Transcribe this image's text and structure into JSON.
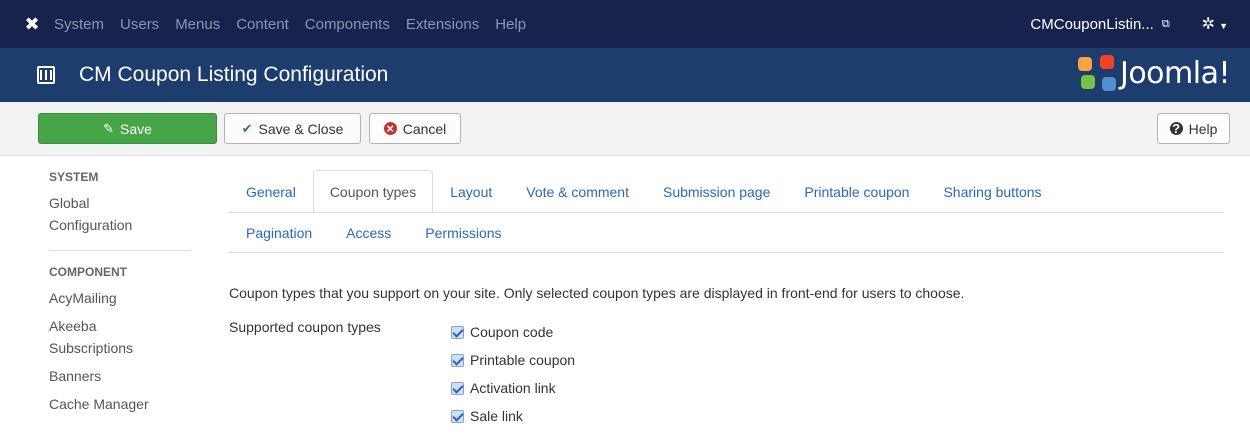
{
  "navbar": {
    "menu": [
      "System",
      "Users",
      "Menus",
      "Content",
      "Components",
      "Extensions",
      "Help"
    ],
    "site_link": "CMCouponListin...",
    "settings_icon": "gear-icon"
  },
  "header": {
    "title": "CM Coupon Listing Configuration",
    "logo_text": "Joomla!"
  },
  "toolbar": {
    "save_label": "Save",
    "save_close_label": "Save & Close",
    "cancel_label": "Cancel",
    "help_label": "Help"
  },
  "sidebar": {
    "system_heading": "SYSTEM",
    "system_items": [
      "Global Configuration"
    ],
    "component_heading": "COMPONENT",
    "component_items": [
      "AcyMailing",
      "Akeeba Subscriptions",
      "Banners",
      "Cache Manager"
    ]
  },
  "tabs": {
    "row1": [
      "General",
      "Coupon types",
      "Layout",
      "Vote & comment",
      "Submission page",
      "Printable coupon",
      "Sharing buttons"
    ],
    "row2": [
      "Pagination",
      "Access",
      "Permissions"
    ],
    "active": "Coupon types"
  },
  "content": {
    "description": "Coupon types that you support on your site. Only selected coupon types are displayed in front-end for users to choose.",
    "field_label": "Supported coupon types",
    "options": [
      {
        "label": "Coupon code",
        "checked": true
      },
      {
        "label": "Printable coupon",
        "checked": true
      },
      {
        "label": "Activation link",
        "checked": true
      },
      {
        "label": "Sale link",
        "checked": true
      }
    ]
  },
  "colors": {
    "navbar_bg": "#17234d",
    "header_bg": "#1c3d6e",
    "save_green": "#46a546",
    "link_blue": "#2a69b8"
  }
}
